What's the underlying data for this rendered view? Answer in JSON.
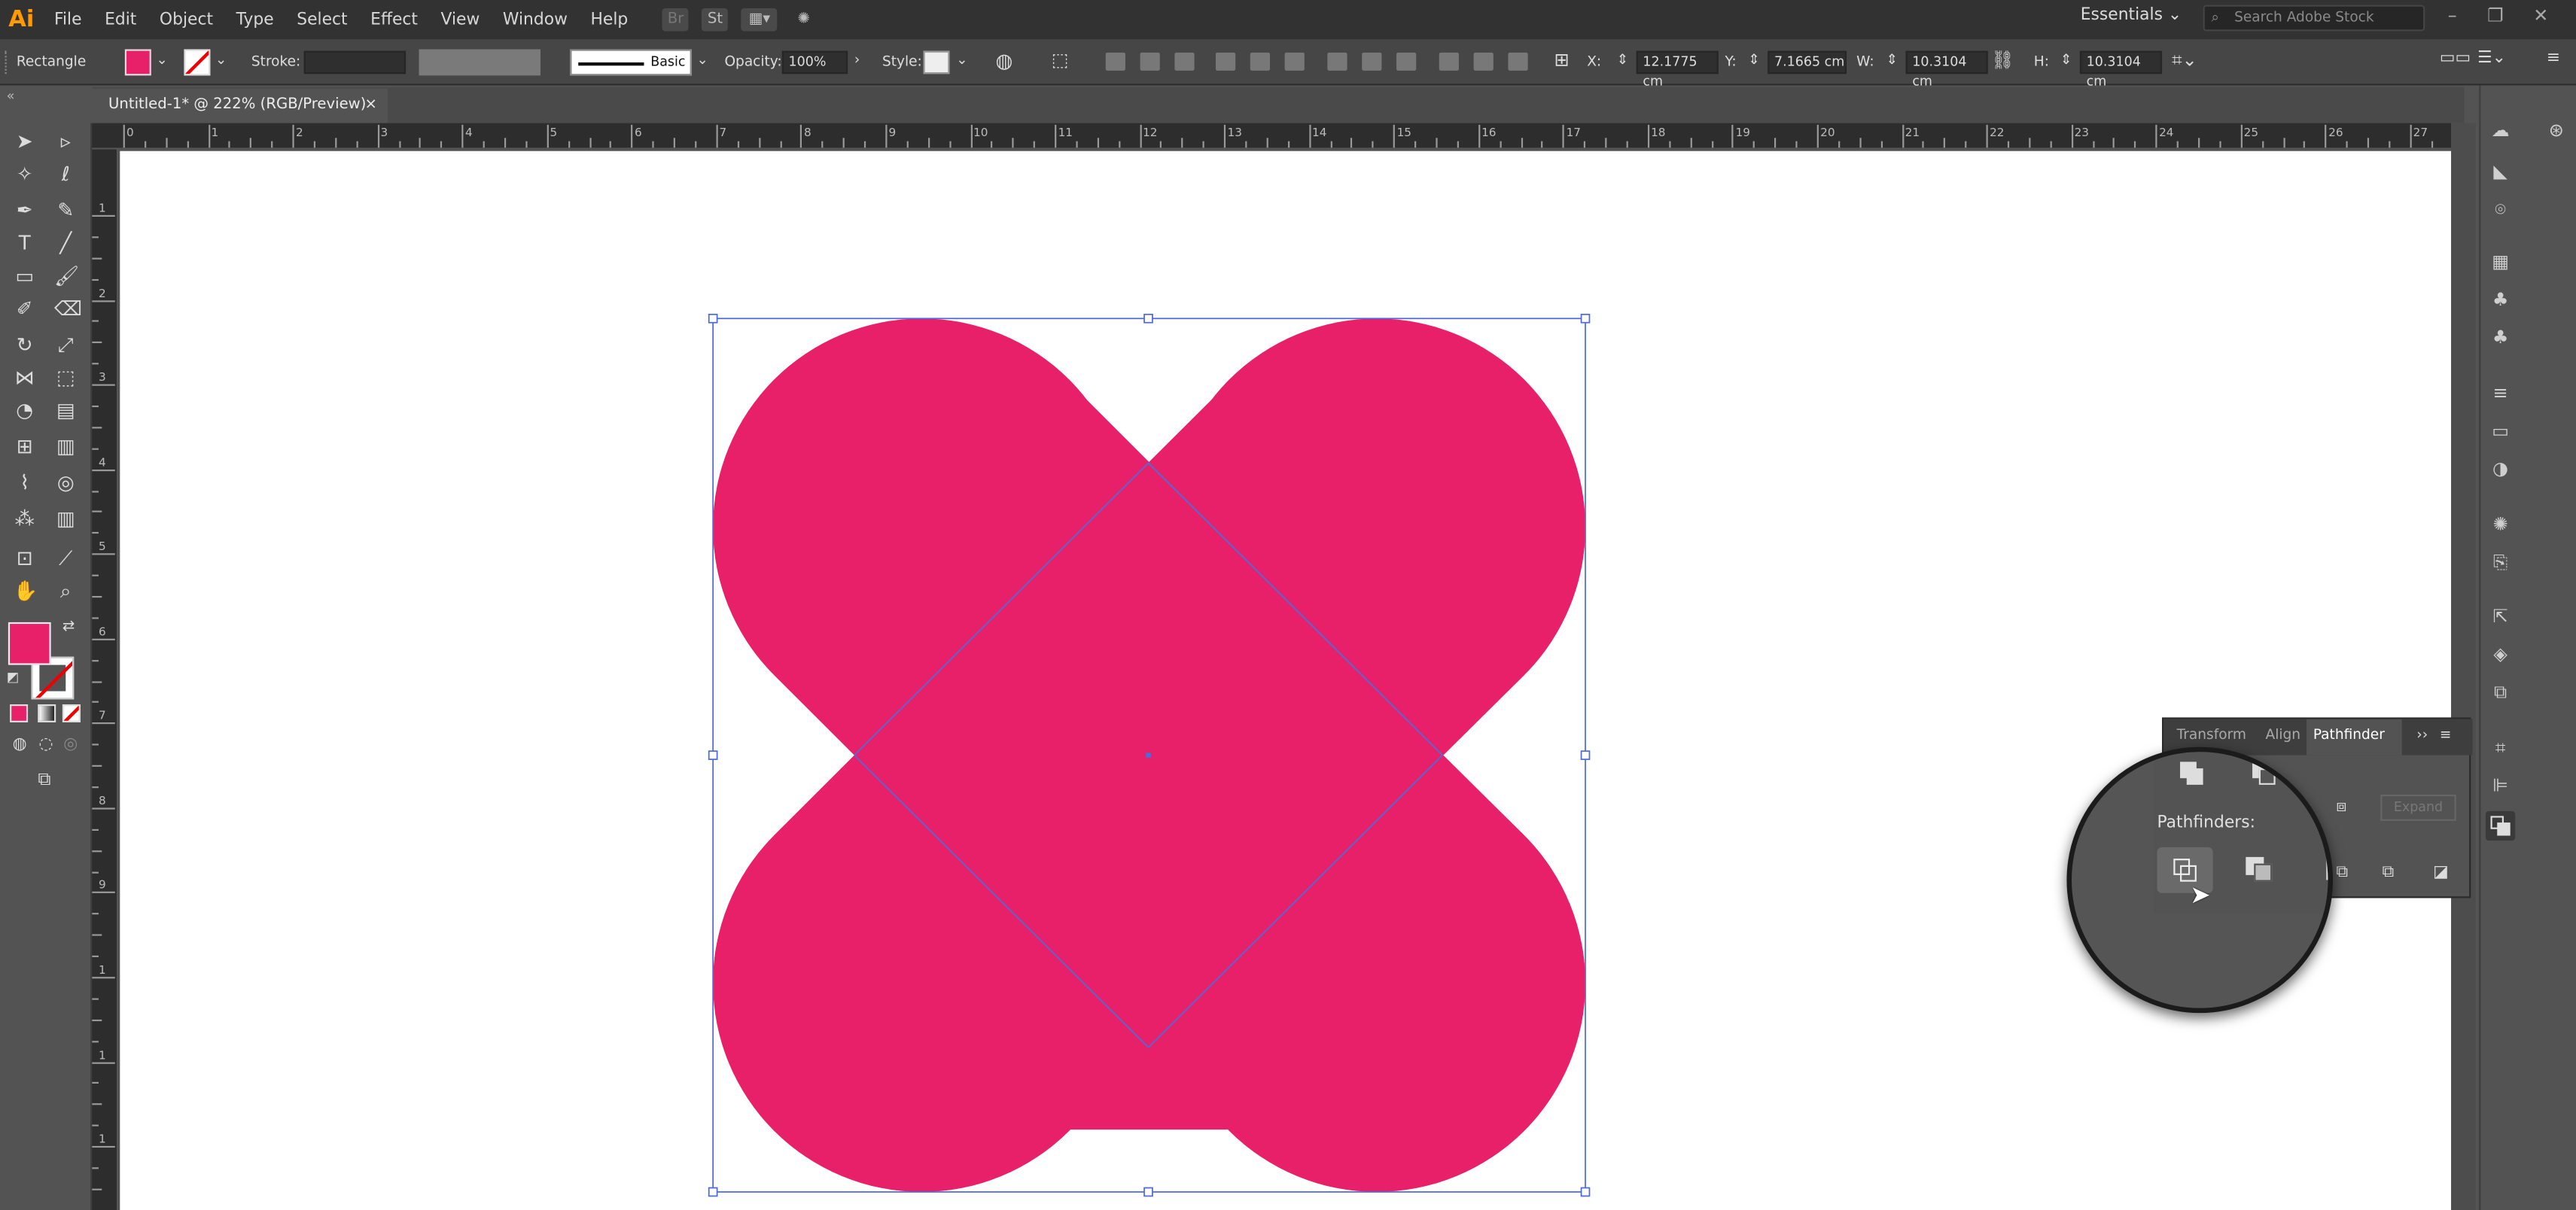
{
  "app": {
    "logo": "Ai",
    "workspace": "Essentials",
    "search_placeholder": "Search Adobe Stock"
  },
  "menus": [
    "File",
    "Edit",
    "Object",
    "Type",
    "Select",
    "Effect",
    "View",
    "Window",
    "Help"
  ],
  "menu_icons": {
    "br": "Br",
    "st": "St"
  },
  "control_bar": {
    "object_type": "Rectangle",
    "stroke_label": "Stroke:",
    "brush": "Basic",
    "opacity_label": "Opacity:",
    "opacity_value": "100%",
    "style_label": "Style:",
    "x_label": "X:",
    "x_value": "12.1775 cm",
    "y_label": "Y:",
    "y_value": "7.1665 cm",
    "w_label": "W:",
    "w_value": "10.3104 cm",
    "h_label": "H:",
    "h_value": "10.3104 cm"
  },
  "document_tab": {
    "title": "Untitled-1* @ 222% (RGB/Preview)",
    "close": "×"
  },
  "ruler": {
    "h_numbers": [
      "0",
      "1",
      "2",
      "3",
      "4",
      "5",
      "6",
      "7",
      "8",
      "9",
      "10",
      "11",
      "12",
      "13",
      "14",
      "15",
      "16",
      "17",
      "18",
      "19",
      "20",
      "21",
      "22",
      "23",
      "24",
      "25",
      "26",
      "27"
    ],
    "v_numbers": [
      "1",
      "2",
      "3",
      "4",
      "5",
      "6",
      "7",
      "8",
      "9",
      "1",
      "1",
      "1"
    ]
  },
  "colors": {
    "fill": "#e8206a",
    "selection": "#4f6bd8",
    "ui_dark": "#323232",
    "ui_mid": "#535353",
    "canvas": "#ffffff"
  },
  "pathfinder_panel": {
    "tabs": [
      "Transform",
      "Align",
      "Pathfinder"
    ],
    "active_tab": "Pathfinder",
    "section_label": "Pathfinders:",
    "expand_label": "Expand"
  }
}
